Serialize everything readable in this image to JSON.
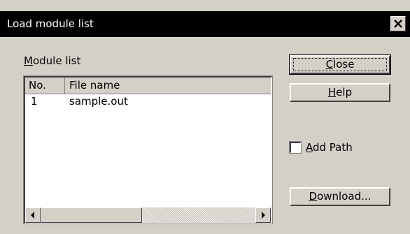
{
  "window": {
    "title": "Load module list",
    "close_glyph": "×"
  },
  "module_list": {
    "label_mnemonic": "M",
    "label_rest": "odule list",
    "columns": [
      "No.",
      "File name"
    ],
    "rows": [
      {
        "no": "1",
        "file_name": "sample.out"
      }
    ]
  },
  "buttons": {
    "close": {
      "mnemonic": "C",
      "rest": "lose"
    },
    "help": {
      "mnemonic": "H",
      "rest": "elp"
    },
    "download": {
      "mnemonic": "D",
      "rest": "ownload..."
    }
  },
  "add_path": {
    "mnemonic": "A",
    "rest": "dd Path",
    "checked": false
  }
}
